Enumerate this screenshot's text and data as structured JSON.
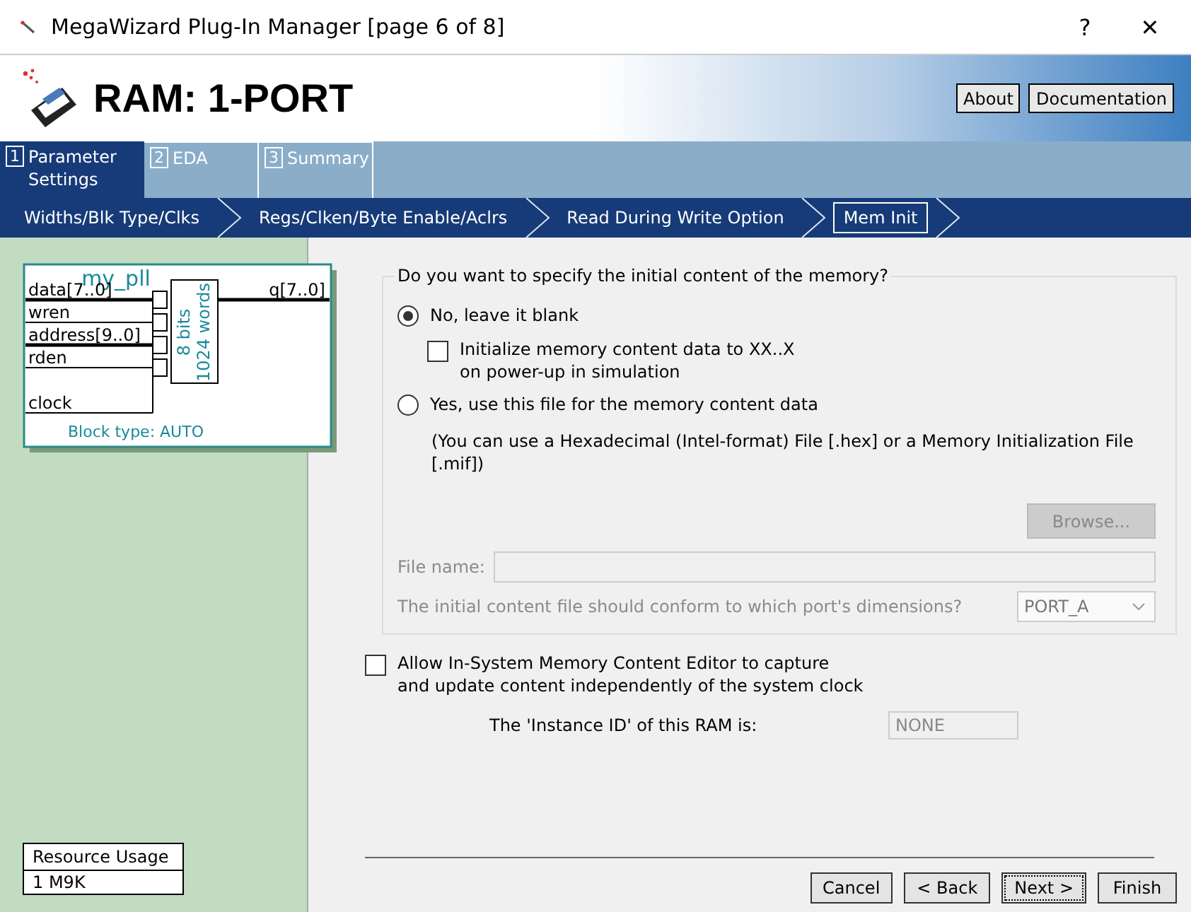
{
  "window": {
    "title": "MegaWizard Plug-In Manager [page 6 of 8]",
    "help": "?",
    "close": "✕"
  },
  "header": {
    "title": "RAM: 1-PORT",
    "buttons": [
      "About",
      "Documentation"
    ]
  },
  "tabs": [
    {
      "number": "1",
      "label": "Parameter Settings",
      "selected": true
    },
    {
      "number": "2",
      "label": "EDA",
      "selected": false
    },
    {
      "number": "3",
      "label": "Summary",
      "selected": false
    }
  ],
  "steps": [
    {
      "label": "Widths/Blk Type/Clks",
      "selected": false
    },
    {
      "label": "Regs/Clken/Byte Enable/Aclrs",
      "selected": false
    },
    {
      "label": "Read During Write Option",
      "selected": false
    },
    {
      "label": "Mem Init",
      "selected": true
    }
  ],
  "diagram": {
    "title": "my_pll",
    "inputs": [
      "data[7..0]",
      "wren",
      "address[9..0]",
      "rden",
      "clock"
    ],
    "output": "q[7..0]",
    "memory": [
      "8 bits",
      "1024 words"
    ],
    "block_type": "Block type: AUTO"
  },
  "resource_usage": {
    "title": "Resource Usage",
    "value": "1 M9K"
  },
  "mem_init": {
    "question": "Do you want to specify the initial content of the memory?",
    "options": [
      {
        "label": "No, leave it blank",
        "selected": true
      },
      {
        "label": "Yes, use this file for the memory content data",
        "selected": false
      }
    ],
    "init_xx": {
      "label": "Initialize memory content data to XX..X on power-up in simulation",
      "checked": false
    },
    "hint": "(You can use a Hexadecimal (Intel-format) File [.hex] or a Memory Initialization File [.mif])",
    "browse": {
      "label": "Browse...",
      "disabled": true
    },
    "file_name": {
      "label": "File name:",
      "disabled": true
    },
    "port": {
      "label": "The initial content file should conform to which port's dimensions?",
      "value": "PORT_A",
      "disabled": true
    }
  },
  "isme": {
    "label": "Allow In-System Memory Content Editor to capture and update content independently of the system clock",
    "checked": false
  },
  "instance_id": {
    "label": "The 'Instance ID' of this RAM is:",
    "value": "NONE",
    "disabled": true
  },
  "footer_buttons": [
    {
      "label": "Cancel",
      "focused": false
    },
    {
      "label": "< Back",
      "focused": false
    },
    {
      "label": "Next >",
      "focused": true
    },
    {
      "label": "Finish",
      "focused": false
    }
  ]
}
